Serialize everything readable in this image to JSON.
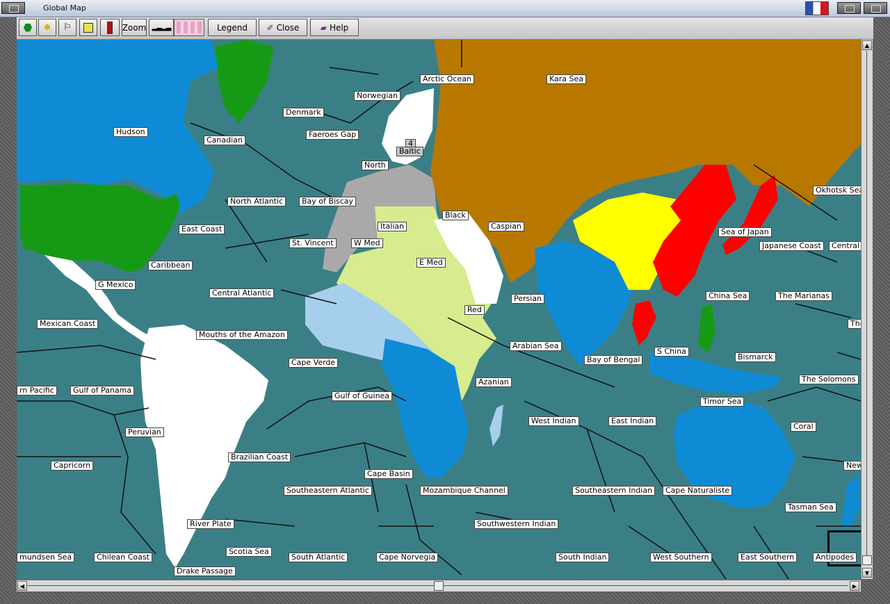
{
  "window": {
    "title": "Global Map"
  },
  "toolbar": {
    "buttons": [
      {
        "name": "units-button",
        "icon": "green-hexagon-icon",
        "label": ""
      },
      {
        "name": "resources-button",
        "icon": "star-icon",
        "label": ""
      },
      {
        "name": "flag-button",
        "icon": "flag-icon",
        "label": ""
      },
      {
        "name": "city-button",
        "icon": "building-icon",
        "label": ""
      },
      {
        "name": "supply-button",
        "icon": "tower-icon",
        "label": ""
      },
      {
        "name": "zoom-button",
        "icon": "",
        "label": "Zoom"
      },
      {
        "name": "fleet-button",
        "icon": "ships-icon",
        "label": ""
      },
      {
        "name": "minimap-button",
        "icon": "minimap-icon",
        "label": ""
      },
      {
        "name": "legend-button",
        "icon": "",
        "label": "Legend"
      },
      {
        "name": "close-button",
        "icon": "close-icon",
        "label": "Close"
      },
      {
        "name": "help-button",
        "icon": "book-icon",
        "label": "Help"
      }
    ]
  },
  "colors": {
    "ocean": "#3b7f86",
    "ussr": "#b87800",
    "usa": "#169a16",
    "japan": "#ff0000",
    "china": "#ffff00",
    "germany": "#a9a9a9",
    "italy": "#d6ec8e",
    "britain": "#0f8bd6",
    "france": "#a6cfee",
    "neutral": "#ffffff"
  },
  "sea_zones": [
    {
      "text": "Arctic Ocean"
    },
    {
      "text": "Kara Sea"
    },
    {
      "text": "Norwegian"
    },
    {
      "text": "Denmark"
    },
    {
      "text": "Hudson"
    },
    {
      "text": "Canadian"
    },
    {
      "text": "Faeroes Gap"
    },
    {
      "text": "4",
      "grey": true
    },
    {
      "text": "Baltic",
      "grey": true
    },
    {
      "text": "North"
    },
    {
      "text": "North Atlantic"
    },
    {
      "text": "Bay of Biscay"
    },
    {
      "text": "Black"
    },
    {
      "text": "Italian"
    },
    {
      "text": "Caspian"
    },
    {
      "text": "East Coast"
    },
    {
      "text": "St. Vincent"
    },
    {
      "text": "W Med"
    },
    {
      "text": "Okhotsk Sea"
    },
    {
      "text": "Sea of Japan"
    },
    {
      "text": "Japanese Coast"
    },
    {
      "text": "Central P"
    },
    {
      "text": "Caribbean"
    },
    {
      "text": "E Med"
    },
    {
      "text": "G Mexico"
    },
    {
      "text": "Central Atlantic"
    },
    {
      "text": "Persian"
    },
    {
      "text": "China Sea"
    },
    {
      "text": "The Marianas"
    },
    {
      "text": "Red"
    },
    {
      "text": "Mexican Coast"
    },
    {
      "text": "The"
    },
    {
      "text": "Mouths of the Amazon"
    },
    {
      "text": "Arabian Sea"
    },
    {
      "text": "S China"
    },
    {
      "text": "Bismarck"
    },
    {
      "text": "Cape Verde"
    },
    {
      "text": "Bay of Bengal"
    },
    {
      "text": "The Solomons"
    },
    {
      "text": "rn Pacific"
    },
    {
      "text": "Gulf of Panama"
    },
    {
      "text": "Azanian"
    },
    {
      "text": "Gulf of Guinea"
    },
    {
      "text": "Timor Sea"
    },
    {
      "text": "West Indian"
    },
    {
      "text": "East Indian"
    },
    {
      "text": "Coral"
    },
    {
      "text": "Peruvian"
    },
    {
      "text": "Brazilian Coast"
    },
    {
      "text": "Capricorn"
    },
    {
      "text": "New Z"
    },
    {
      "text": "Cape Basin"
    },
    {
      "text": "Southeastern Atlantic"
    },
    {
      "text": "Mozambique Channel"
    },
    {
      "text": "Southeastern Indian"
    },
    {
      "text": "Cape Naturaliste"
    },
    {
      "text": "Tasman Sea"
    },
    {
      "text": "Southwestern Indian"
    },
    {
      "text": "River Plate"
    },
    {
      "text": "Scotia Sea"
    },
    {
      "text": "mundsen Sea"
    },
    {
      "text": "Chilean Coast"
    },
    {
      "text": "South Atlantic"
    },
    {
      "text": "Cape Norvegia"
    },
    {
      "text": "South Indian"
    },
    {
      "text": "West Southern"
    },
    {
      "text": "East Southern"
    },
    {
      "text": "Antipodes"
    },
    {
      "text": "Drake Passage"
    }
  ]
}
